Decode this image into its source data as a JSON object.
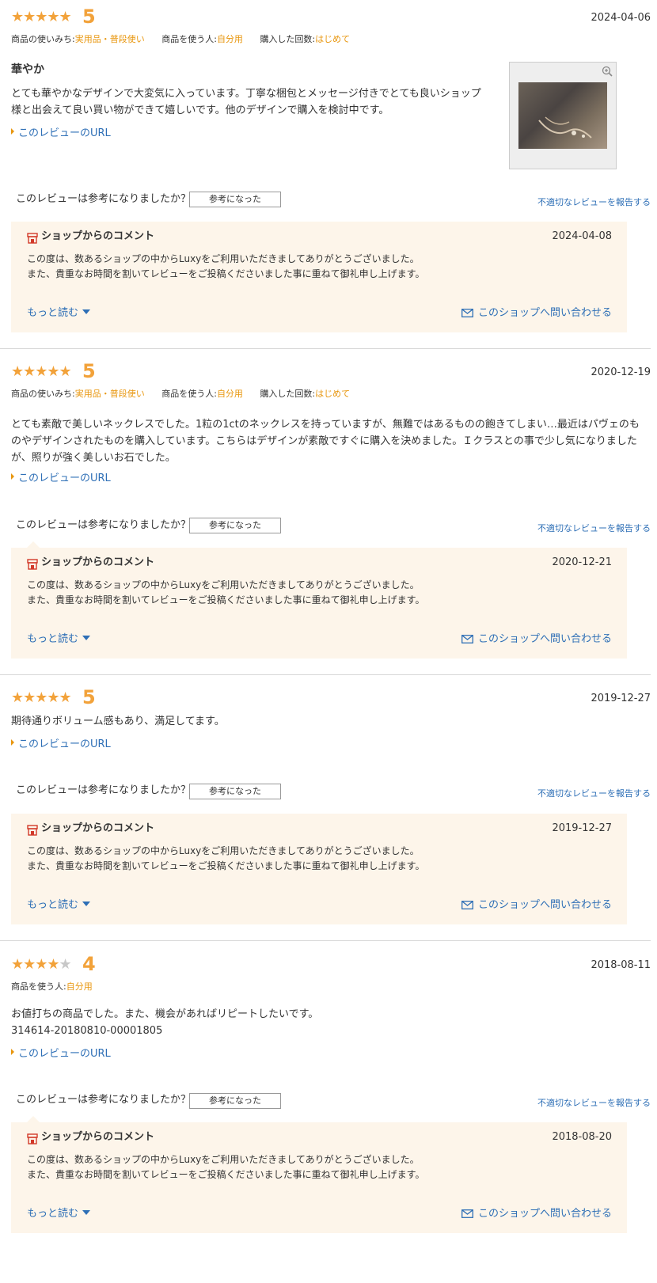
{
  "reviews": [
    {
      "stars_text": "★★★★★",
      "stars_off_text": "",
      "rating": 5,
      "date": "2024-04-06",
      "meta": [
        {
          "label": "商品の使いみち:",
          "value": "実用品・普段使い"
        },
        {
          "label": "商品を使う人:",
          "value": "自分用"
        },
        {
          "label": "購入した回数:",
          "value": "はじめて"
        }
      ],
      "title": "華やか",
      "body_lines": [
        "とても華やかなデザインで大変気に入っています。丁寧な梱包とメッセージ付きでとても良いショップ",
        "様と出会えて良い買い物ができて嬉しいです。他のデザインで購入を検討中です。"
      ],
      "url_label": "このレビューのURL",
      "has_image": true,
      "helpful_question": "このレビューは参考になりましたか？",
      "helpful_button": "参考になった",
      "report_label": "不適切なレビューを報告する",
      "shop_comment": {
        "title": "ショップからのコメント",
        "date": "2024-04-08",
        "lines": [
          "この度は、数あるショップの中からLuxyをご利用いただきましてありがとうございました。",
          "また、貴重なお時間を割いてレビューをご投稿くださいました事に重ねて御礼申し上げます。"
        ],
        "more_label": "もっと読む",
        "contact_label": "このショップへ問い合わせる"
      }
    },
    {
      "stars_text": "★★★★★",
      "stars_off_text": "",
      "rating": 5,
      "date": "2020-12-19",
      "meta": [
        {
          "label": "商品の使いみち:",
          "value": "実用品・普段使い"
        },
        {
          "label": "商品を使う人:",
          "value": "自分用"
        },
        {
          "label": "購入した回数:",
          "value": "はじめて"
        }
      ],
      "title": "",
      "body_lines": [
        "とても素敵で美しいネックレスでした。1粒の1ctのネックレスを持っていますが、無難ではあるものの飽きてしまい…最近はパヴェのも",
        "のやデザインされたものを購入しています。こちらはデザインが素敵ですぐに購入を決めました。Ｉクラスとの事で少し気になりました",
        "が、照りが強く美しいお石でした。"
      ],
      "url_label": "このレビューのURL",
      "has_image": false,
      "helpful_question": "このレビューは参考になりましたか？",
      "helpful_button": "参考になった",
      "report_label": "不適切なレビューを報告する",
      "shop_comment": {
        "title": "ショップからのコメント",
        "date": "2020-12-21",
        "lines": [
          "この度は、数あるショップの中からLuxyをご利用いただきましてありがとうございました。",
          "また、貴重なお時間を割いてレビューをご投稿くださいました事に重ねて御礼申し上げます。"
        ],
        "more_label": "もっと読む",
        "contact_label": "このショップへ問い合わせる"
      }
    },
    {
      "stars_text": "★★★★★",
      "stars_off_text": "",
      "rating": 5,
      "date": "2019-12-27",
      "meta": [],
      "title": "",
      "body_lines": [
        "期待通りボリューム感もあり、満足してます。"
      ],
      "url_label": "このレビューのURL",
      "has_image": false,
      "helpful_question": "このレビューは参考になりましたか？",
      "helpful_button": "参考になった",
      "report_label": "不適切なレビューを報告する",
      "shop_comment": {
        "title": "ショップからのコメント",
        "date": "2019-12-27",
        "lines": [
          "この度は、数あるショップの中からLuxyをご利用いただきましてありがとうございました。",
          "また、貴重なお時間を割いてレビューをご投稿くださいました事に重ねて御礼申し上げます。"
        ],
        "more_label": "もっと読む",
        "contact_label": "このショップへ問い合わせる"
      }
    },
    {
      "stars_text": "★★★★",
      "stars_off_text": "★",
      "rating": 4,
      "date": "2018-08-11",
      "meta": [
        {
          "label": "商品を使う人:",
          "value": "自分用"
        }
      ],
      "title": "",
      "body_lines": [
        "お値打ちの商品でした。また、機会があればリピートしたいです。",
        "314614-20180810-00001805"
      ],
      "url_label": "このレビューのURL",
      "has_image": false,
      "helpful_question": "このレビューは参考になりましたか？",
      "helpful_button": "参考になった",
      "report_label": "不適切なレビューを報告する",
      "shop_comment": {
        "title": "ショップからのコメント",
        "date": "2018-08-20",
        "lines": [
          "この度は、数あるショップの中からLuxyをご利用いただきましてありがとうございました。",
          "また、貴重なお時間を割いてレビューをご投稿くださいました事に重ねて御礼申し上げます。"
        ],
        "more_label": "もっと読む",
        "contact_label": "このショップへ問い合わせる"
      }
    }
  ],
  "colors": {
    "accent_orange": "#f2a23a",
    "meta_value": "#e8960d",
    "link_blue": "#2e6fb6",
    "shop_bg": "#fdf5ea",
    "shop_icon_red": "#d23a2a"
  },
  "icons": {
    "zoom": "zoom-in-icon",
    "shop": "shop-icon",
    "mail": "mail-icon",
    "caret": "caret-down-icon",
    "url_marker": "triangle-right-icon"
  }
}
